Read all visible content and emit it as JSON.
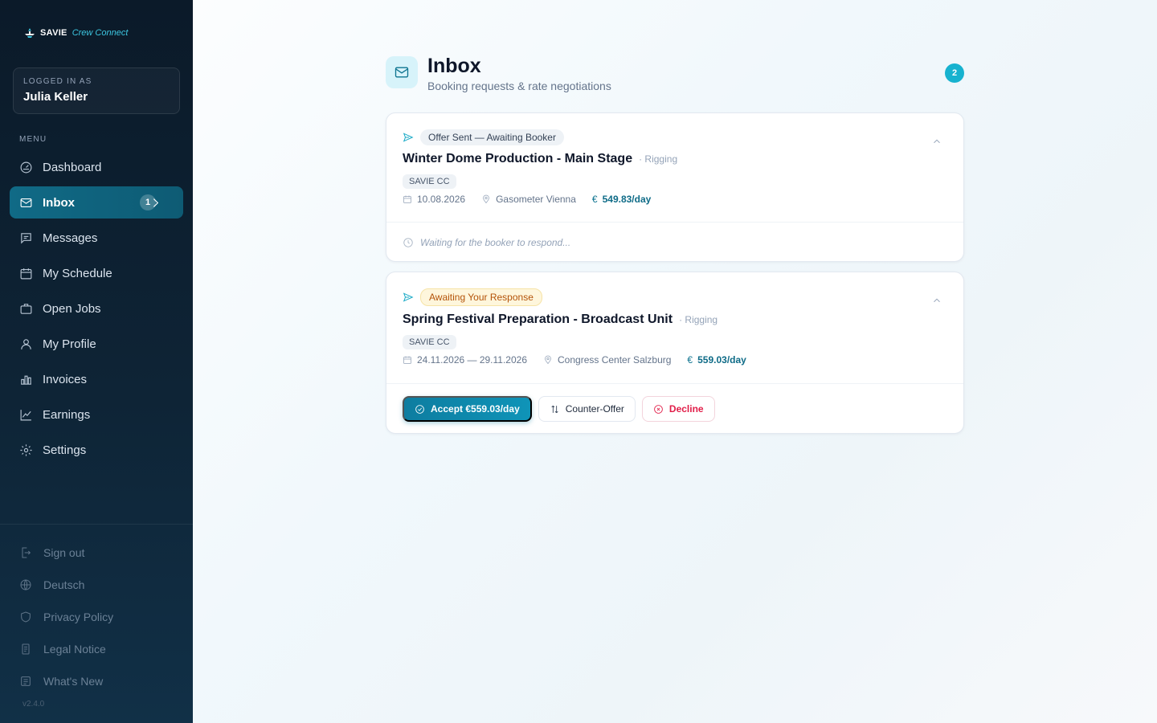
{
  "brand": {
    "name": "SAVIE",
    "product": "Crew Connect"
  },
  "login": {
    "label": "LOGGED IN AS",
    "user": "Julia Keller"
  },
  "menu_title": "MENU",
  "nav": [
    {
      "label": "Dashboard",
      "icon": "dashboard-icon"
    },
    {
      "label": "Inbox",
      "icon": "inbox-icon",
      "badge": "1",
      "active": true
    },
    {
      "label": "Messages",
      "icon": "messages-icon"
    },
    {
      "label": "My Schedule",
      "icon": "calendar-icon"
    },
    {
      "label": "Open Jobs",
      "icon": "briefcase-icon"
    },
    {
      "label": "My Profile",
      "icon": "user-icon"
    },
    {
      "label": "Invoices",
      "icon": "invoices-icon"
    },
    {
      "label": "Earnings",
      "icon": "earnings-icon"
    },
    {
      "label": "Settings",
      "icon": "gear-icon"
    }
  ],
  "bottom_nav": [
    {
      "label": "Sign out",
      "icon": "sign-out-icon"
    },
    {
      "label": "Deutsch",
      "icon": "globe-icon"
    },
    {
      "label": "Privacy Policy",
      "icon": "shield-icon"
    },
    {
      "label": "Legal Notice",
      "icon": "document-icon"
    },
    {
      "label": "What's New",
      "icon": "news-icon"
    }
  ],
  "version": "v2.4.0",
  "header": {
    "title": "Inbox",
    "subtitle": "Booking requests & rate negotiations",
    "count": "2"
  },
  "cards": [
    {
      "status": "Offer Sent — Awaiting Booker",
      "title": "Winter Dome Production - Main Stage",
      "role": "· Rigging",
      "org": "SAVIE CC",
      "date": "10.08.2026",
      "location": "Gasometer Vienna",
      "currency": "€",
      "rate": "549.83/day",
      "waiting": "Waiting for the booker to respond..."
    },
    {
      "status": "Awaiting Your Response",
      "title": "Spring Festival Preparation - Broadcast Unit",
      "role": "· Rigging",
      "org": "SAVIE CC",
      "date": "24.11.2026 — 29.11.2026",
      "location": "Congress Center Salzburg",
      "currency": "€",
      "rate": "559.03/day",
      "actions": {
        "accept": "Accept €559.03/day",
        "counter": "Counter-Offer",
        "decline": "Decline"
      }
    }
  ],
  "colors": {
    "accent": "#17b2cf",
    "sidebar_active": "#106a86",
    "decline": "#e11d48",
    "pending_pill": "#b45309"
  }
}
